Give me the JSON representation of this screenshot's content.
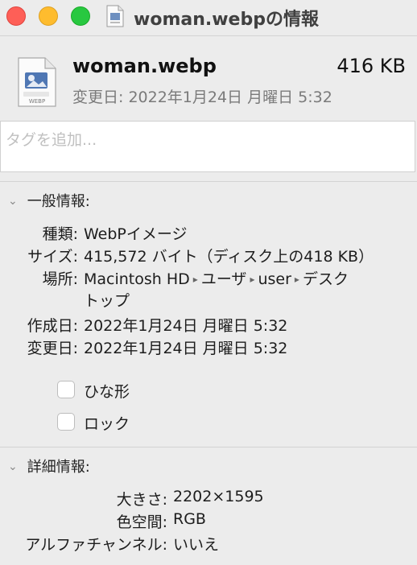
{
  "window": {
    "title": "woman.webpの情報"
  },
  "header": {
    "file_name": "woman.webp",
    "size": "416 KB",
    "modified": "変更日: 2022年1月24日 月曜日 5:32",
    "icon_label": "WEBP"
  },
  "tags": {
    "placeholder": "タグを追加..."
  },
  "general": {
    "heading": "一般情報:",
    "kind_label": "種類:",
    "kind_value": "WebPイメージ",
    "size_label": "サイズ:",
    "size_value": "415,572 バイト（ディスク上の418 KB）",
    "where_label": "場所:",
    "where_path": [
      "Macintosh HD",
      "ユーザ",
      "user",
      "デスク"
    ],
    "where_path_cont": "トップ",
    "created_label": "作成日:",
    "created_value": "2022年1月24日 月曜日 5:32",
    "modified_label": "変更日:",
    "modified_value": "2022年1月24日 月曜日 5:32",
    "stationery_label": "ひな形",
    "locked_label": "ロック"
  },
  "more_info": {
    "heading": "詳細情報:",
    "dimensions_label": "大きさ:",
    "dimensions_value": "2202×1595",
    "color_space_label": "色空間:",
    "color_space_value": "RGB",
    "alpha_label": "アルファチャンネル:",
    "alpha_value": "いいえ"
  },
  "colors": {
    "close": "#fe5f57",
    "minimize": "#febc2e",
    "zoom": "#28c840"
  }
}
